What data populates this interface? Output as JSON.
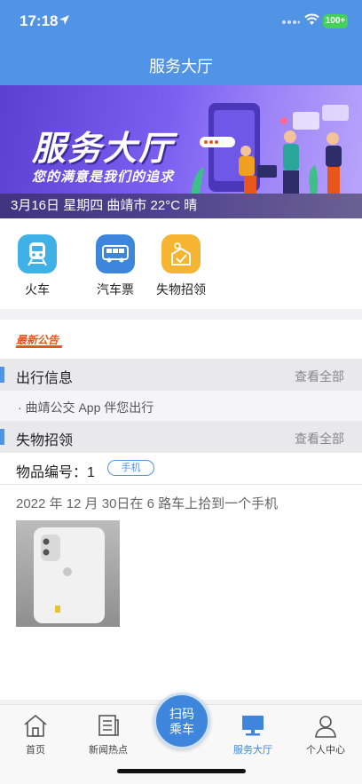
{
  "status": {
    "time": "17:18",
    "battery": "100+"
  },
  "nav": {
    "title": "服务大厅"
  },
  "banner": {
    "headline": "服务大厅",
    "slogan": "您的满意是我们的追求",
    "info": "3月16日 星期四 曲靖市 22°C 晴"
  },
  "quick": [
    {
      "label": "火车",
      "icon": "train-icon",
      "color": "#3fb1e6"
    },
    {
      "label": "汽车票",
      "icon": "bus-icon",
      "color": "#3d86db"
    },
    {
      "label": "失物招领",
      "icon": "lost-found-icon",
      "color": "#f5b533"
    }
  ],
  "notice": {
    "tag": "最新公告"
  },
  "travel": {
    "title": "出行信息",
    "more": "查看全部",
    "item": "· 曲靖公交 App 伴您出行"
  },
  "lost": {
    "title": "失物招领",
    "more": "查看全部",
    "number_label": "物品编号：1",
    "badge": "手机",
    "description": "2022 年 12 月 30日在 6 路车上拾到一个手机"
  },
  "scan": {
    "line1": "扫码",
    "line2": "乘车"
  },
  "tabs": [
    {
      "label": "首页",
      "icon": "home-icon"
    },
    {
      "label": "新闻热点",
      "icon": "news-icon"
    },
    {
      "label": "服务大厅",
      "icon": "service-hall-icon",
      "active": true
    },
    {
      "label": "个人中心",
      "icon": "profile-icon"
    }
  ],
  "colors": {
    "primary": "#5194e6",
    "accent": "#3d86db",
    "notice": "#e8561c"
  }
}
